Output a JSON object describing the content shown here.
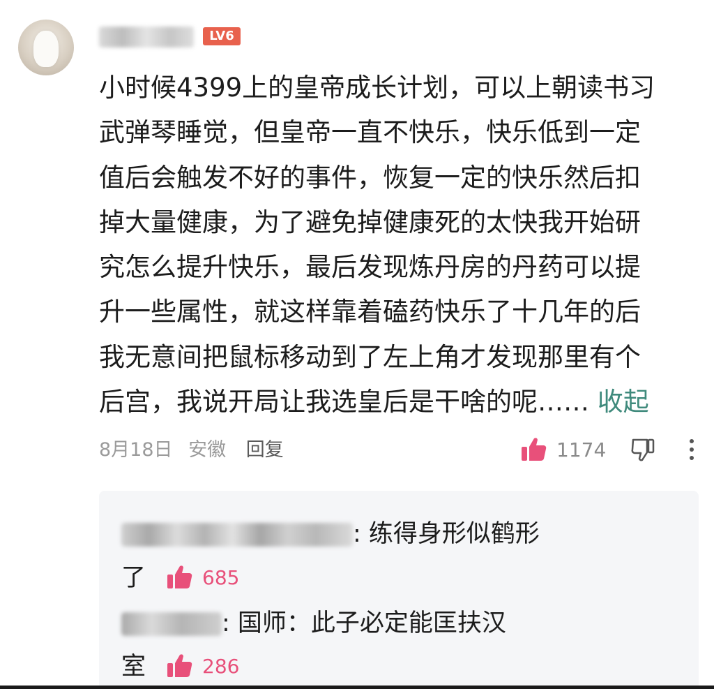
{
  "comment": {
    "level_badge": "LV6",
    "text_lines": [
      "小时候4399上的皇帝成长计划，可以上朝读书习",
      "武弹琴睡觉，但皇帝一直不快乐，快乐低到一定",
      "值后会触发不好的事件，恢复一定的快乐然后扣",
      "掉大量健康，为了避免掉健康死的太快我开始研",
      "究怎么提升快乐，最后发现炼丹房的丹药可以提",
      "升一些属性，就这样靠着磕药快乐了十几年的后",
      "我无意间把鼠标移动到了左上角才发现那里有个",
      "后宫，我说开局让我选皇后是干啥的呢……"
    ],
    "collapse_label": "收起",
    "date": "8月18日",
    "location": "安徽",
    "reply_label": "回复",
    "like_count": "1174"
  },
  "replies": [
    {
      "text_line1": ": 练得身形似鹤形",
      "text_line2": "了",
      "like_count": "685"
    },
    {
      "text_line1": ": 国师：此子必定能匡扶汉",
      "text_line2": "室",
      "like_count": "286"
    }
  ],
  "colors": {
    "accent_like": "#e8507a",
    "collapse_link": "#3f8a7c",
    "level_badge": "#e8614d"
  }
}
